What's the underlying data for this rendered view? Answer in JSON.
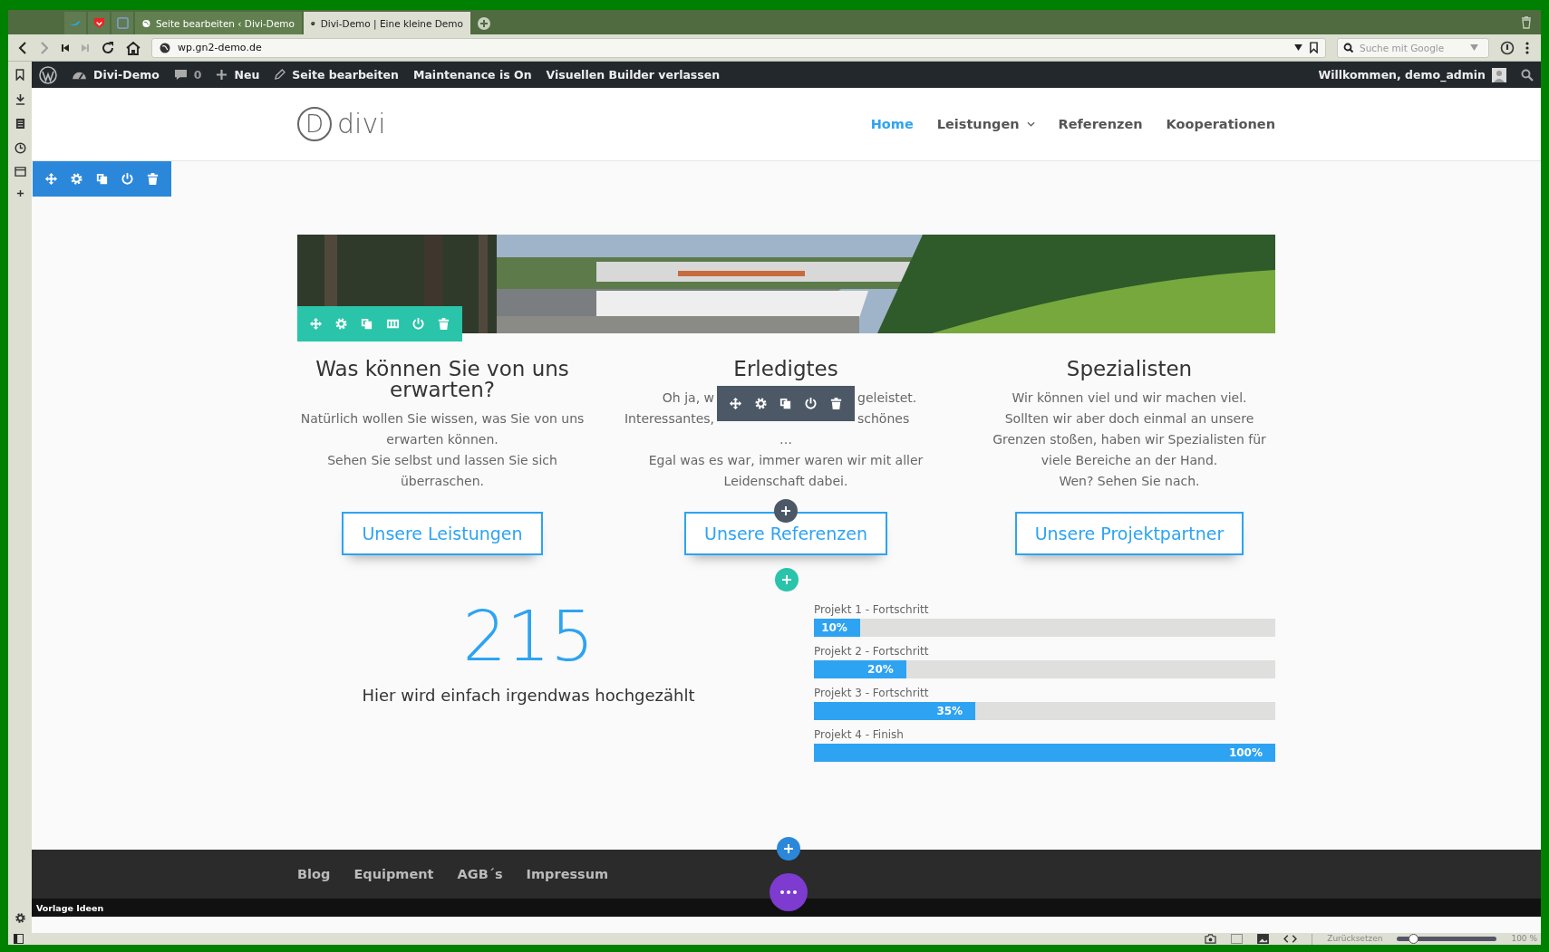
{
  "browser": {
    "tabs": [
      {
        "title": "Seite bearbeiten ‹ Divi-Demo",
        "selected": false
      },
      {
        "title": "Divi-Demo | Eine kleine Demo",
        "selected": true
      }
    ],
    "address": "wp.gn2-demo.de",
    "search": {
      "placeholder": "Suche mit Google"
    }
  },
  "admin_bar": {
    "items": [
      {
        "kind": "site",
        "label": "Divi-Demo"
      },
      {
        "kind": "comments",
        "label": "0"
      },
      {
        "kind": "new",
        "label": "Neu"
      },
      {
        "kind": "edit",
        "label": "Seite bearbeiten"
      },
      {
        "kind": "text",
        "label": "Maintenance is On"
      },
      {
        "kind": "text",
        "label": "Visuellen Builder verlassen"
      }
    ],
    "account": "Willkommen, demo_admin"
  },
  "header": {
    "logo_letter": "D",
    "logo": "divi",
    "nav": [
      {
        "label": "Home",
        "selected": true,
        "has_submenu": false
      },
      {
        "label": "Leistungen",
        "selected": false,
        "has_submenu": true
      },
      {
        "label": "Referenzen",
        "selected": false,
        "has_submenu": false
      },
      {
        "label": "Kooperationen",
        "selected": false,
        "has_submenu": false
      }
    ]
  },
  "columns": [
    {
      "title": "Was können Sie von uns erwarten?",
      "paragraphs": [
        {
          "parts": [
            "Natürlich wollen Sie wissen, was Sie von uns erwarten können."
          ]
        },
        {
          "parts": [
            "Sehen Sie selbst und lassen Sie sich überraschen."
          ]
        }
      ],
      "button": "Unsere Leistungen"
    },
    {
      "title": "Erledigtes",
      "paragraphs": [
        {
          "parts": [
            "Oh ja, w",
            "geleistet."
          ]
        },
        {
          "parts": [
            "Interessantes,",
            "schönes"
          ]
        },
        {
          "parts": [
            "…"
          ]
        },
        {
          "parts": [
            "Egal was es war, immer waren wir mit aller Leidenschaft dabei."
          ]
        }
      ],
      "button": "Unsere Referenzen"
    },
    {
      "title": "Spezialisten",
      "paragraphs": [
        {
          "parts": [
            "Wir können viel und wir machen viel."
          ]
        },
        {
          "parts": [
            "Sollten wir aber doch einmal an unsere Grenzen stoßen, haben wir Spezialisten für viele Bereiche an der Hand."
          ]
        },
        {
          "parts": [
            "Wen? Sehen Sie nach."
          ]
        }
      ],
      "button": "Unsere Projektpartner"
    }
  ],
  "counter": {
    "number": "215",
    "title": "Hier wird einfach irgendwas hochgezählt"
  },
  "bars": [
    {
      "label": "Projekt 1 - Fortschritt",
      "level": 0.1,
      "reading": "10%"
    },
    {
      "label": "Projekt 2 - Fortschritt",
      "level": 0.2,
      "reading": "20%"
    },
    {
      "label": "Projekt 3 - Fortschritt",
      "level": 0.35,
      "reading": "35%"
    },
    {
      "label": "Projekt 4 - Finish",
      "level": 1,
      "reading": "100%"
    }
  ],
  "footer": {
    "links": [
      "Blog",
      "Equipment",
      "AGB´s",
      "Impressum"
    ],
    "bottom_text": "Vorlage Ideen"
  },
  "status_bar": {
    "reset": "Zurücksetzen",
    "zoom": {
      "level": 0.17
    },
    "zoom_reading": "100 %"
  }
}
